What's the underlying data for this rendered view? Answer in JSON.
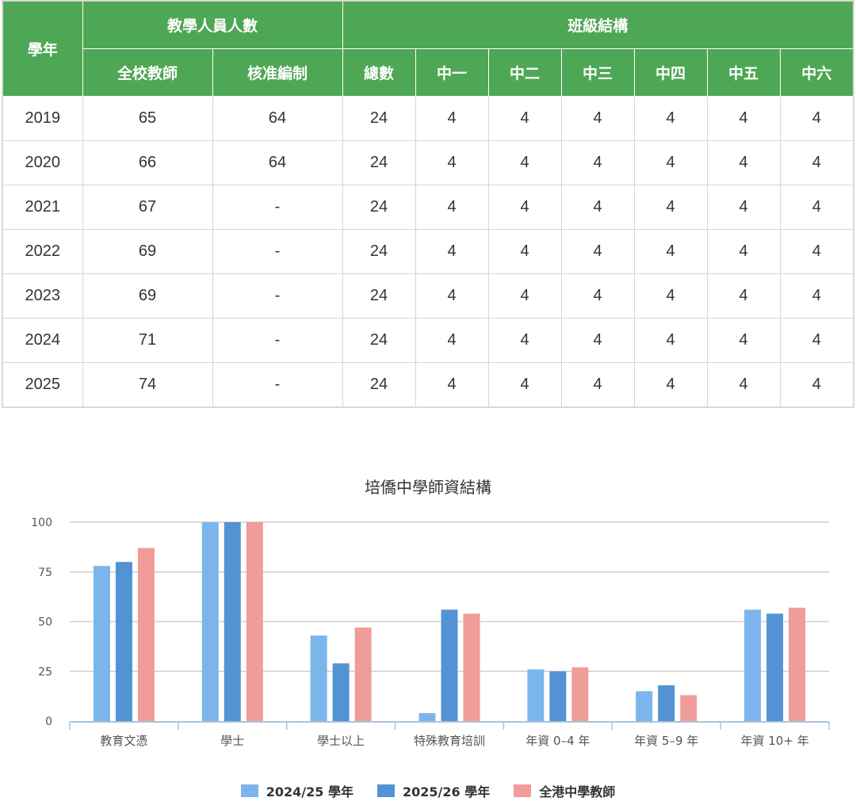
{
  "table": {
    "headers": {
      "year": "學年",
      "staff_group": "教學人員人數",
      "class_group": "班級結構",
      "staff_cols": [
        "全校教師",
        "核准編制"
      ],
      "class_cols": [
        "總數",
        "中一",
        "中二",
        "中三",
        "中四",
        "中五",
        "中六"
      ]
    },
    "rows": [
      [
        "2019",
        "65",
        "64",
        "24",
        "4",
        "4",
        "4",
        "4",
        "4",
        "4"
      ],
      [
        "2020",
        "66",
        "64",
        "24",
        "4",
        "4",
        "4",
        "4",
        "4",
        "4"
      ],
      [
        "2021",
        "67",
        "-",
        "24",
        "4",
        "4",
        "4",
        "4",
        "4",
        "4"
      ],
      [
        "2022",
        "69",
        "-",
        "24",
        "4",
        "4",
        "4",
        "4",
        "4",
        "4"
      ],
      [
        "2023",
        "69",
        "-",
        "24",
        "4",
        "4",
        "4",
        "4",
        "4",
        "4"
      ],
      [
        "2024",
        "71",
        "-",
        "24",
        "4",
        "4",
        "4",
        "4",
        "4",
        "4"
      ],
      [
        "2025",
        "74",
        "-",
        "24",
        "4",
        "4",
        "4",
        "4",
        "4",
        "4"
      ]
    ]
  },
  "chart_data": {
    "type": "bar",
    "title": "培僑中學師資結構",
    "categories": [
      "教育文憑",
      "學士",
      "學士以上",
      "特殊教育培訓",
      "年資 0–4 年",
      "年資 5–9 年",
      "年資 10+ 年"
    ],
    "series": [
      {
        "name": "2024/25 學年",
        "color": "#7cb5ec",
        "values": [
          78,
          100,
          43,
          4,
          26,
          15,
          56
        ]
      },
      {
        "name": "2025/26 學年",
        "color": "#5393d3",
        "values": [
          80,
          100,
          29,
          56,
          25,
          18,
          54
        ]
      },
      {
        "name": "全港中學教師",
        "color": "#f09c98",
        "values": [
          87,
          100,
          47,
          54,
          27,
          13,
          57
        ]
      }
    ],
    "ylim": [
      0,
      100
    ],
    "yticks": [
      "0",
      "25",
      "50",
      "75",
      "100"
    ],
    "grid": true,
    "legend_position": "bottom"
  }
}
